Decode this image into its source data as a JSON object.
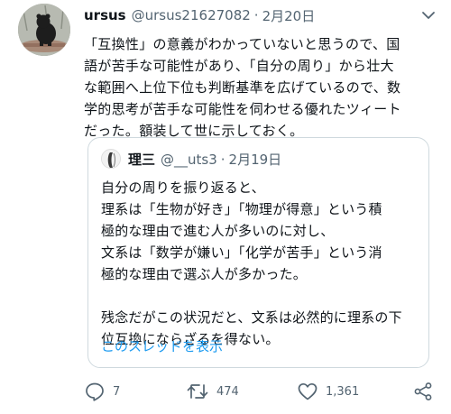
{
  "tweet": {
    "user_name": "ursus",
    "handle": "@ursus21627082",
    "separator": "·",
    "date": "2月20日",
    "text": "「互換性」の意義がわかっていないと思うので、国\n語が苦手な可能性があり、「自分の周り」から壮大\nな範囲へ上位下位も判断基準を広げているので、数\n学的思考が苦手な可能性を伺わせる優れたツィート\nだった。額装して世に示しておく。"
  },
  "quote": {
    "user_name": "理三",
    "handle": "@__uts3",
    "separator": "·",
    "date": "2月19日",
    "text": "自分の周りを振り返ると、\n理系は「生物が好き」「物理が得意」という積\n極的な理由で進む人が多いのに対し、\n文系は「数学が嫌い」「化学が苦手」という消\n極的な理由で選ぶ人が多かった。\n\n残念だがこの状況だと、文系は必然的に理系の下\n位互換にならざるを得ない。",
    "thread_link": "このスレッドを表示"
  },
  "actions": {
    "reply_count": "7",
    "retweet_count": "474",
    "like_count": "1,361"
  },
  "colors": {
    "text": "#0f1419",
    "secondary": "#536471",
    "link": "#1d9bf0",
    "border": "#cfd9de"
  }
}
